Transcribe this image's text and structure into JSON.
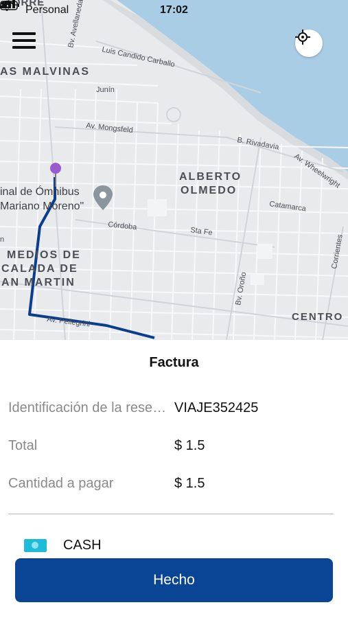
{
  "status_bar": {
    "carrier": "Personal",
    "time": "17:02"
  },
  "map": {
    "labels": {
      "torre": "TORRE",
      "malvinas": "AS MALVINAS",
      "luis_candido": "Luis Candido Carballo",
      "bv_avellaneda": "Bv. Avellaneda",
      "junin": "Junín",
      "mongsfeld": "Av. Mongsfeld",
      "rivadavia": "B. Rivadavia",
      "wheelwright": "Av. Wheelwright",
      "alberto": "ALBERTO",
      "olmedo": "OLMEDO",
      "terminal_1": "inal de Ómnibus",
      "terminal_2": "Mariano Moreno\"",
      "catamarca": "Catamarca",
      "cordoba": "Córdoba",
      "sta_fe": "Sta Fe",
      "medios_1": "MEDIOS DE",
      "medios_2": "CALADA DE",
      "medios_3": "AN MARTIN",
      "corrientes": "Corrientes",
      "orono": "Bv. Oroño",
      "pellegrini": "Av. Pellegrini",
      "centro": "CENTRO",
      "n": "n"
    },
    "colors": {
      "land": "#e8eaec",
      "water": "#aacde6",
      "route": "#0a3c8f",
      "pin": "#9b59d0"
    }
  },
  "invoice": {
    "title": "Factura",
    "rows": [
      {
        "label": "Identificación de la reserva",
        "value": "VIAJE352425"
      },
      {
        "label": "Total",
        "value": "$ 1.5"
      },
      {
        "label": "Cantidad a pagar",
        "value": "$ 1.5"
      }
    ],
    "payment_method": "CASH",
    "payment_icon": "cash-icon",
    "done_button": "Hecho",
    "accent": "#0a4595"
  }
}
